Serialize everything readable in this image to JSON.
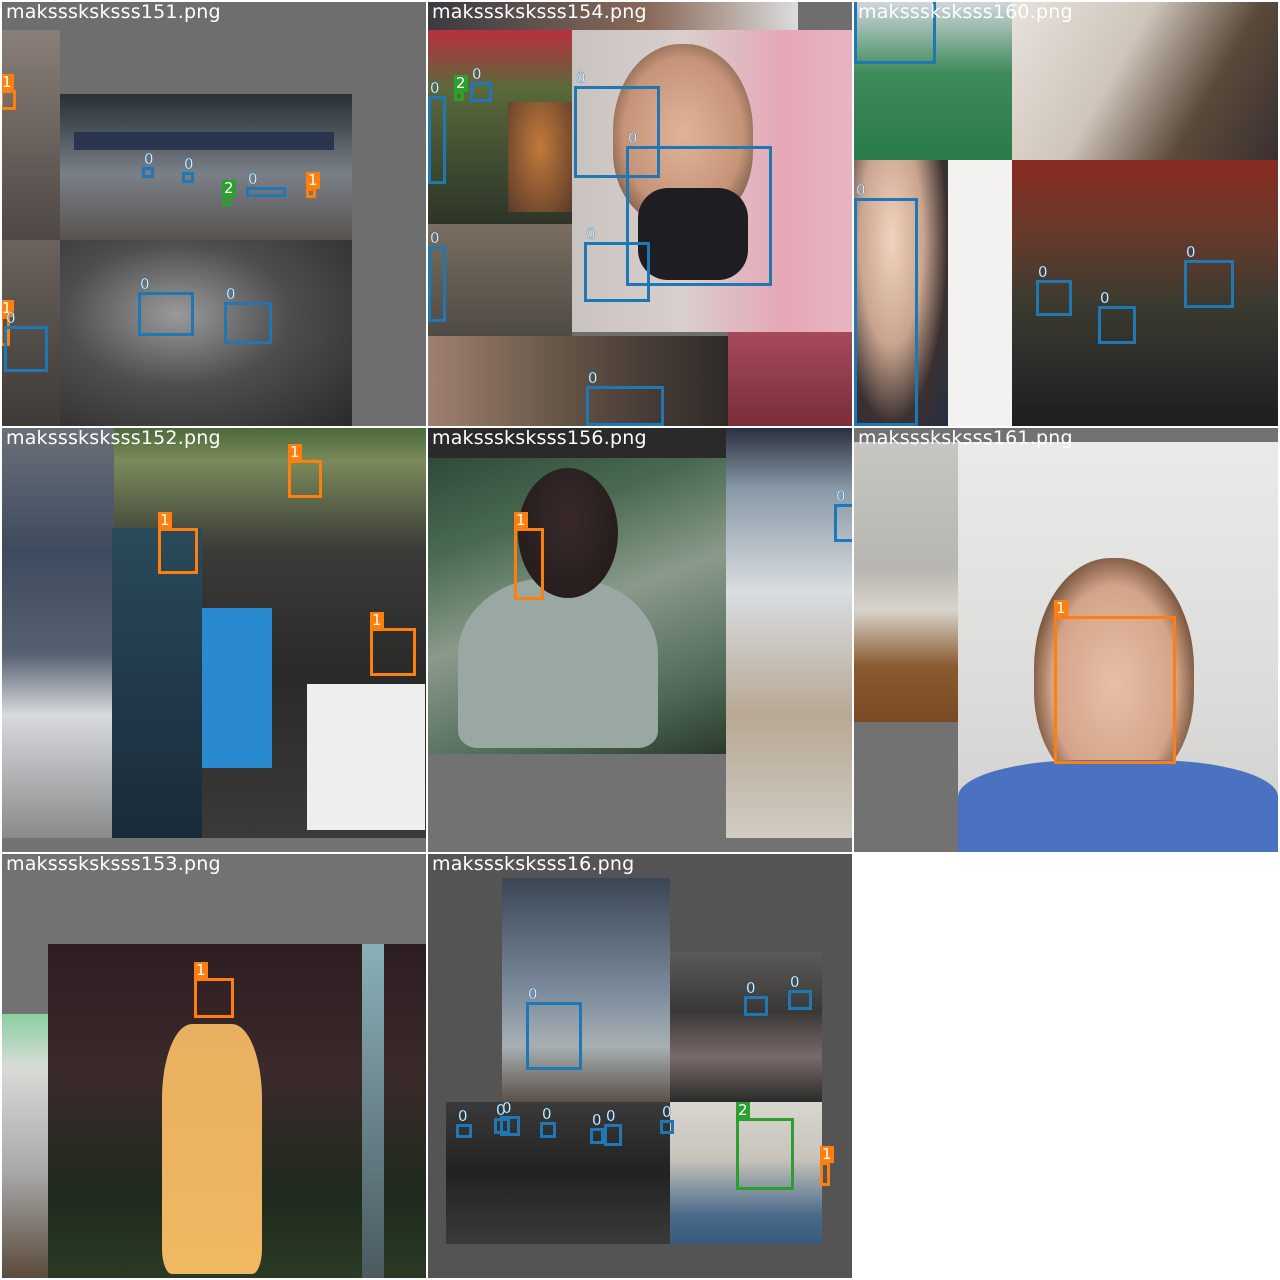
{
  "colors": {
    "class0": "#1f77b4",
    "class1": "#ff7f0e",
    "class2": "#2ca02c",
    "tile_bg": "#727272",
    "page_bg": "#ffffff"
  },
  "tiles": [
    {
      "title": "maksssksksss151.png",
      "boxes": [
        {
          "cls": "1",
          "label": "1"
        },
        {
          "cls": "0",
          "label": "0"
        },
        {
          "cls": "0",
          "label": "0"
        },
        {
          "cls": "2",
          "label": "2"
        },
        {
          "cls": "0",
          "label": "0"
        },
        {
          "cls": "1",
          "label": "1"
        },
        {
          "cls": "0",
          "label": "0"
        },
        {
          "cls": "0",
          "label": "0"
        },
        {
          "cls": "1",
          "label": "1"
        },
        {
          "cls": "0",
          "label": "0"
        }
      ]
    },
    {
      "title": "maksssksksss154.png",
      "boxes": [
        {
          "cls": "2",
          "label": "2"
        },
        {
          "cls": "0",
          "label": "0"
        },
        {
          "cls": "0",
          "label": "0"
        },
        {
          "cls": "0",
          "label": "0"
        },
        {
          "cls": "0",
          "label": "0"
        },
        {
          "cls": "0",
          "label": "0"
        },
        {
          "cls": "0",
          "label": "0"
        },
        {
          "cls": "0",
          "label": "0"
        }
      ]
    },
    {
      "title": "maksssksksss160.png",
      "boxes": [
        {
          "cls": "0",
          "label": "0"
        },
        {
          "cls": "0",
          "label": "0"
        },
        {
          "cls": "0",
          "label": "0"
        },
        {
          "cls": "0",
          "label": "0"
        },
        {
          "cls": "0",
          "label": "0"
        }
      ]
    },
    {
      "title": "maksssksksss152.png",
      "boxes": [
        {
          "cls": "1",
          "label": "1"
        },
        {
          "cls": "1",
          "label": "1"
        },
        {
          "cls": "1",
          "label": "1"
        }
      ]
    },
    {
      "title": "maksssksksss156.png",
      "boxes": [
        {
          "cls": "1",
          "label": "1"
        },
        {
          "cls": "0",
          "label": "0"
        }
      ]
    },
    {
      "title": "maksssksksss161.png",
      "boxes": [
        {
          "cls": "1",
          "label": "1"
        }
      ]
    },
    {
      "title": "maksssksksss153.png",
      "boxes": [
        {
          "cls": "1",
          "label": "1"
        }
      ]
    },
    {
      "title": "maksssksksss16.png",
      "boxes": [
        {
          "cls": "0",
          "label": "0"
        },
        {
          "cls": "0",
          "label": "0"
        },
        {
          "cls": "0",
          "label": "0"
        },
        {
          "cls": "0",
          "label": "0"
        },
        {
          "cls": "0",
          "label": "0"
        },
        {
          "cls": "0",
          "label": "0"
        },
        {
          "cls": "0",
          "label": "0"
        },
        {
          "cls": "0",
          "label": "0"
        },
        {
          "cls": "0",
          "label": "0"
        },
        {
          "cls": "0",
          "label": "0"
        },
        {
          "cls": "2",
          "label": "2"
        },
        {
          "cls": "1",
          "label": "1"
        }
      ]
    }
  ]
}
